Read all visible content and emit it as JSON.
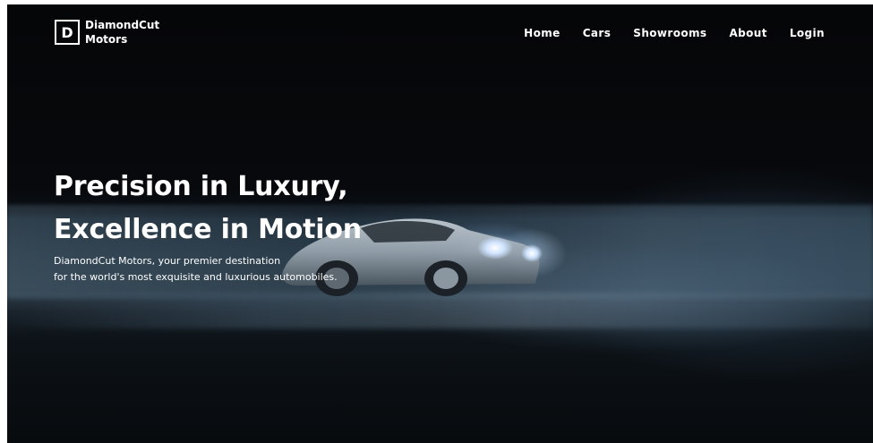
{
  "brand": {
    "logo_letter": "D",
    "name_line1": "DiamondCut",
    "name_line2": "Motors"
  },
  "nav": {
    "items": [
      {
        "label": "Home"
      },
      {
        "label": "Cars"
      },
      {
        "label": "Showrooms"
      },
      {
        "label": "About"
      },
      {
        "label": "Login"
      }
    ]
  },
  "hero": {
    "title_line1": "Precision in Luxury,",
    "title_line2": "Excellence in Motion",
    "subtitle_line1": "DiamondCut Motors, your premier destination",
    "subtitle_line2": "for the world's most exquisite and luxurious automobiles."
  },
  "colors": {
    "background": "#05070a",
    "text": "#ffffff"
  }
}
